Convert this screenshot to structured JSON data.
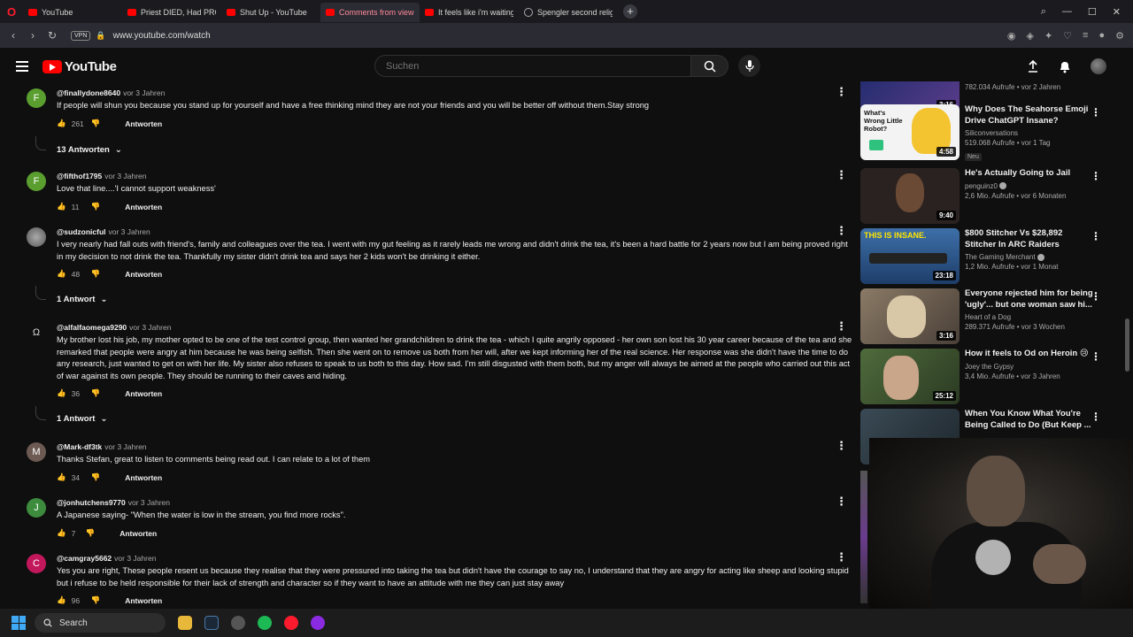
{
  "browser": {
    "tabs": [
      {
        "title": "YouTube",
        "active": false
      },
      {
        "title": "Priest DIED, Had PROFOUND",
        "active": false
      },
      {
        "title": "Shut Up - YouTube",
        "active": false
      },
      {
        "title": "Comments from viewers",
        "active": true
      },
      {
        "title": "It feels like i'm waiting to",
        "active": false
      },
      {
        "title": "Spengler second religious",
        "active": false
      }
    ],
    "url": "www.youtube.com/watch",
    "vpn_label": "VPN"
  },
  "header": {
    "logo_text": "YouTube",
    "search_placeholder": "Suchen"
  },
  "comments": [
    {
      "author": "@finallydone8640",
      "time": "vor 3 Jahren",
      "avatar_letter": "F",
      "avatar_color": "#5a9e2f",
      "text": "If people will shun you because you stand up for yourself and have a free thinking mind they are not your friends and you will be better off without them.Stay strong",
      "likes": "261",
      "reply_label": "Antworten",
      "replies_toggle": "13 Antworten"
    },
    {
      "author": "@fifthof1795",
      "time": "vor 3 Jahren",
      "avatar_letter": "F",
      "avatar_color": "#5a9e2f",
      "text": "Love that line....'I cannot support weakness'",
      "likes": "11",
      "reply_label": "Antworten",
      "replies_toggle": ""
    },
    {
      "author": "@sudzonicful",
      "time": "vor 3 Jahren",
      "avatar_letter": "",
      "avatar_color": "#777777",
      "text": "I very nearly had fall outs with friend's, family and colleagues over the tea. I went with my gut feeling as it rarely leads me wrong and didn't drink the tea, it's been a hard battle for 2 years now but I am being proved right in my decision to not drink the tea. Thankfully my sister didn't drink tea and says her 2 kids won't be drinking it either.",
      "likes": "48",
      "reply_label": "Antworten",
      "replies_toggle": "1 Antwort"
    },
    {
      "author": "@alfalfaomega9290",
      "time": "vor 3 Jahren",
      "avatar_letter": "Ω",
      "avatar_color": "#0f0f0f",
      "text": "My brother lost his job, my mother opted to be one of the test control group, then wanted her grandchildren to drink the tea - which I quite angrily opposed - her own son lost his 30 year career because of the tea and she remarked that people were angry at him because he was being selfish. Then she went on to remove us both from her will, after we kept informing her of the real science. Her response was she didn't have the time to do any research, just wanted to get on with her life. My sister also refuses to speak to us both to this day. How sad. I'm still disgusted with them both, but my anger will always be aimed at the people who carried out this act of war against its own people. They should be running to their caves and hiding.",
      "likes": "36",
      "reply_label": "Antworten",
      "replies_toggle": "1 Antwort"
    },
    {
      "author": "@Mark-df3tk",
      "time": "vor 3 Jahren",
      "avatar_letter": "M",
      "avatar_color": "#6d5a52",
      "text": "Thanks Stefan, great to listen to comments being read out. I can relate to a lot of them",
      "likes": "34",
      "reply_label": "Antworten",
      "replies_toggle": ""
    },
    {
      "author": "@jonhutchens9770",
      "time": "vor 3 Jahren",
      "avatar_letter": "J",
      "avatar_color": "#3d8c3d",
      "text": "A Japanese saying- \"When the water is low in the stream, you find more rocks\".",
      "likes": "7",
      "reply_label": "Antworten",
      "replies_toggle": ""
    },
    {
      "author": "@camgray5662",
      "time": "vor 3 Jahren",
      "avatar_letter": "C",
      "avatar_color": "#c2185b",
      "text": "Yes you are right, These people resent us because they realise that they were pressured into taking the tea but didn't have the courage to say no, I understand that they are angry for acting like sheep and looking stupid but i refuse to be held responsible for their lack of strength and character so if they want to have an attitude with me they can just stay away",
      "likes": "96",
      "reply_label": "Antworten",
      "replies_toggle": ""
    }
  ],
  "sidebar": [
    {
      "title": "",
      "channel": "",
      "meta": "782.034 Aufrufe • vor 2 Jahren",
      "duration": "3:16",
      "badge": "",
      "verified": false,
      "thumb_color": "#1c2a6b"
    },
    {
      "title": "Why Does The Seahorse Emoji Drive ChatGPT Insane?",
      "channel": "Siliconversations",
      "meta": "519.068 Aufrufe • vor 1 Tag",
      "duration": "4:58",
      "badge": "Neu",
      "verified": false,
      "thumb_color": "#f3f3f3",
      "thumb_text": "What's Wrong Little Robot?"
    },
    {
      "title": "He's Actually Going to Jail",
      "channel": "penguinz0",
      "meta": "2,6 Mio. Aufrufe • vor 6 Monaten",
      "duration": "9:40",
      "badge": "",
      "verified": true,
      "thumb_color": "#2a2220"
    },
    {
      "title": "$800 Stitcher Vs $28,892 Stitcher In ARC Raiders",
      "channel": "The Gaming Merchant",
      "meta": "1,2 Mio. Aufrufe • vor 1 Monat",
      "duration": "23:18",
      "badge": "",
      "verified": true,
      "thumb_color": "#3d6fa8",
      "thumb_text": "THIS IS INSANE."
    },
    {
      "title": "Everyone rejected him for being 'ugly'... but one woman saw hi...",
      "channel": "Heart of a Dog",
      "meta": "289.371 Aufrufe • vor 3 Wochen",
      "duration": "3:16",
      "badge": "",
      "verified": false,
      "thumb_color": "#8a7a66"
    },
    {
      "title": "How it feels to Od on Heroin 😢",
      "channel": "Joey the Gypsy",
      "meta": "3,4 Mio. Aufrufe • vor 3 Jahren",
      "duration": "25:12",
      "badge": "",
      "verified": false,
      "thumb_color": "#4f6b3c"
    },
    {
      "title": "When You Know What You're Being Called to Do (But Keep ...",
      "channel": "",
      "meta": "",
      "duration": "",
      "badge": "",
      "verified": false,
      "thumb_color": "#3a4a55"
    }
  ],
  "taskbar": {
    "search_label": "Search"
  }
}
